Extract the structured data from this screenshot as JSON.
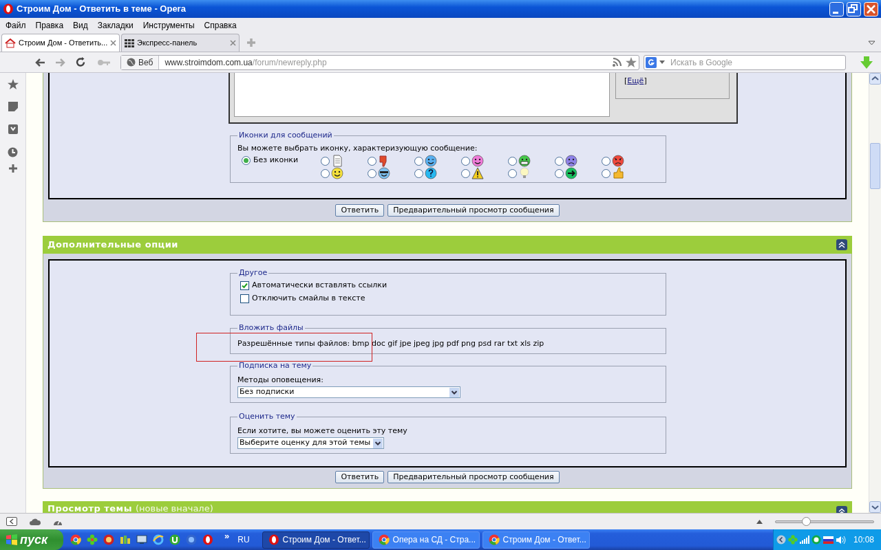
{
  "window": {
    "title": "Строим Дом - Ответить в теме - Opera"
  },
  "menu": [
    "Файл",
    "Правка",
    "Вид",
    "Закладки",
    "Инструменты",
    "Справка"
  ],
  "tabs": [
    {
      "label": "Строим Дом - Ответить...",
      "selected": true
    },
    {
      "label": "Экспресс-панель",
      "selected": false
    }
  ],
  "address_bar": {
    "mode": "Веб",
    "host": "www.stroimdom.com.ua",
    "path": "/forum/newreply.php"
  },
  "search": {
    "placeholder": "Искать в Google"
  },
  "editor": {
    "more_open": "[",
    "more_link": "Ещё",
    "more_close": "]"
  },
  "post_icons": {
    "legend": "Иконки для сообщений",
    "hint": "Вы можете выбрать иконку, характеризующую сообщение:",
    "options": [
      {
        "kind": "none",
        "label": "Без иконки",
        "selected": true
      },
      {
        "kind": "icon",
        "selected": false
      },
      {
        "kind": "icon",
        "selected": false
      },
      {
        "kind": "icon",
        "selected": false
      },
      {
        "kind": "icon",
        "selected": false
      },
      {
        "kind": "icon",
        "selected": false
      },
      {
        "kind": "icon",
        "selected": false
      },
      {
        "kind": "icon",
        "selected": false
      },
      {
        "kind": "icon",
        "selected": false
      },
      {
        "kind": "icon",
        "selected": false
      },
      {
        "kind": "icon",
        "selected": false
      },
      {
        "kind": "icon",
        "selected": false
      },
      {
        "kind": "icon",
        "selected": false
      },
      {
        "kind": "icon",
        "selected": false
      },
      {
        "kind": "icon",
        "selected": false
      }
    ]
  },
  "top_buttons": [
    "Ответить",
    "Предварительный просмотр сообщения"
  ],
  "options_section": {
    "title": "Дополнительные опции",
    "fieldsets": [
      {
        "kind": "checkboxes",
        "legend": "Другое",
        "items": [
          {
            "label": "Автоматически вставлять ссылки",
            "checked": true
          },
          {
            "label": "Отключить смайлы в тексте",
            "checked": false
          }
        ]
      },
      {
        "kind": "text",
        "legend": "Вложить файлы",
        "text": "Разрешённые типы файлов: bmp doc gif jpe jpeg jpg pdf png psd rar txt xls zip"
      },
      {
        "kind": "select",
        "legend": "Подписка на тему",
        "label": "Методы оповещения:",
        "value": "Без подписки"
      },
      {
        "kind": "select",
        "legend": "Оценить тему",
        "label": "Если хотите, вы можете оценить эту тему",
        "value": "Выберите оценку для этой темы"
      }
    ]
  },
  "bottom_buttons": [
    "Ответить",
    "Предварительный просмотр сообщения"
  ],
  "next_section": {
    "title": "Просмотр темы",
    "subtitle": "(новые вначале)"
  },
  "status_bar": {
    "zoom": {
      "level": 0.31
    }
  },
  "taskbar": {
    "start": "пуск",
    "overflow": "»",
    "language": "RU",
    "tasks": [
      {
        "label": "Строим Дом - Ответ...",
        "selected": true
      },
      {
        "label": "Опера на СД - Стра...",
        "selected": false
      },
      {
        "label": "Строим Дом - Ответ...",
        "selected": false
      }
    ],
    "clock": "10:08"
  }
}
